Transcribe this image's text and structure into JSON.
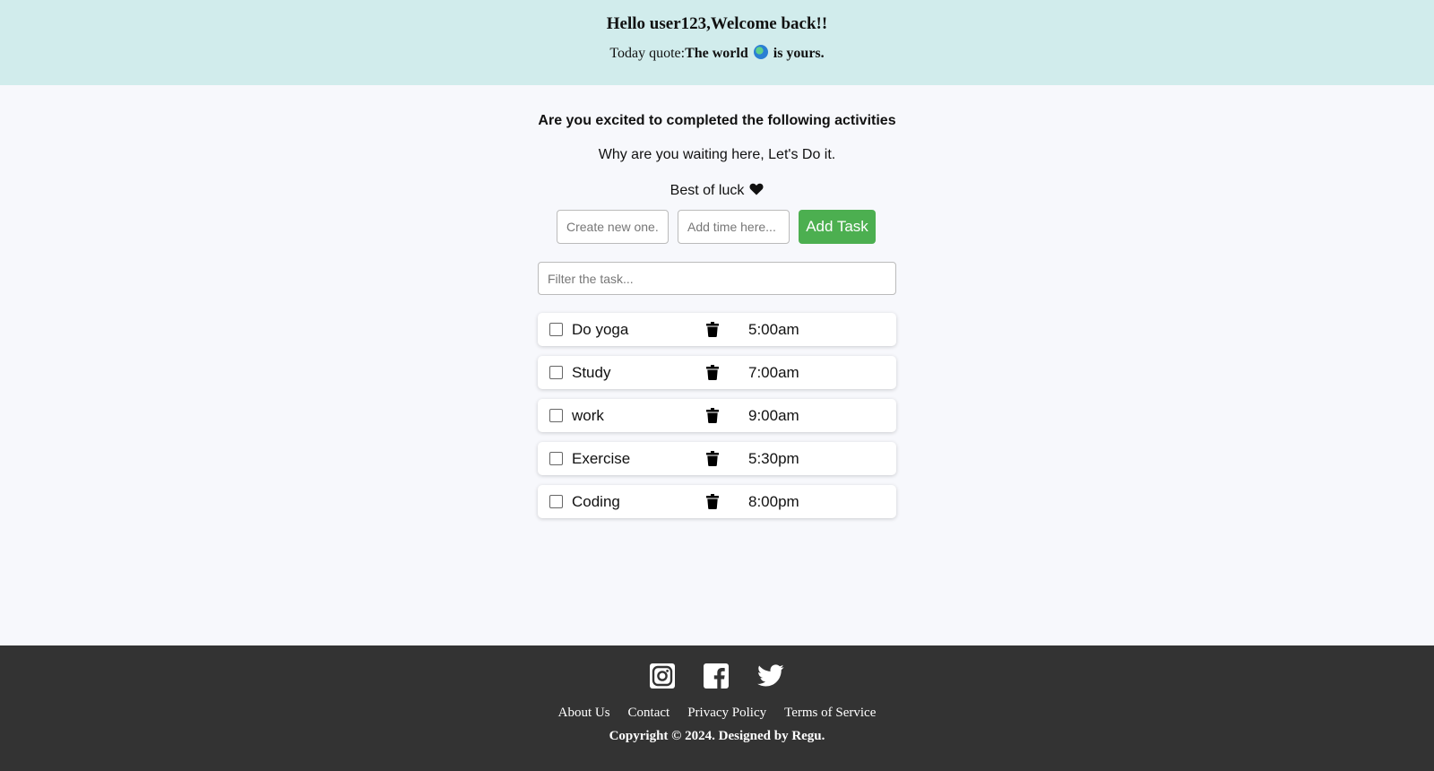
{
  "header": {
    "greeting": "Hello user123,Welcome back!!",
    "quote_prefix": "Today quote:",
    "quote_part1": "The world",
    "quote_part2": "is yours."
  },
  "intro": {
    "title": "Are you excited to completed the following activities",
    "subtitle": "Why are you waiting here, Let's Do it.",
    "luck": "Best of luck"
  },
  "form": {
    "task_placeholder": "Create new one..",
    "time_placeholder": "Add time here...",
    "add_button": "Add Task",
    "filter_placeholder": "Filter the task..."
  },
  "tasks": [
    {
      "name": "Do yoga",
      "time": "5:00am",
      "done": false
    },
    {
      "name": "Study",
      "time": "7:00am",
      "done": false
    },
    {
      "name": "work",
      "time": "9:00am",
      "done": false
    },
    {
      "name": "Exercise",
      "time": "5:30pm",
      "done": false
    },
    {
      "name": "Coding",
      "time": "8:00pm",
      "done": false
    }
  ],
  "footer": {
    "social_icons": [
      "instagram-icon",
      "facebook-icon",
      "twitter-icon"
    ],
    "links": [
      "About Us",
      "Contact",
      "Privacy Policy",
      "Terms of Service"
    ],
    "copyright": "Copyright © 2024. Designed by Regu."
  },
  "colors": {
    "header_bg": "#d1ecec",
    "add_button_bg": "#4caf50",
    "footer_bg": "#333333"
  }
}
